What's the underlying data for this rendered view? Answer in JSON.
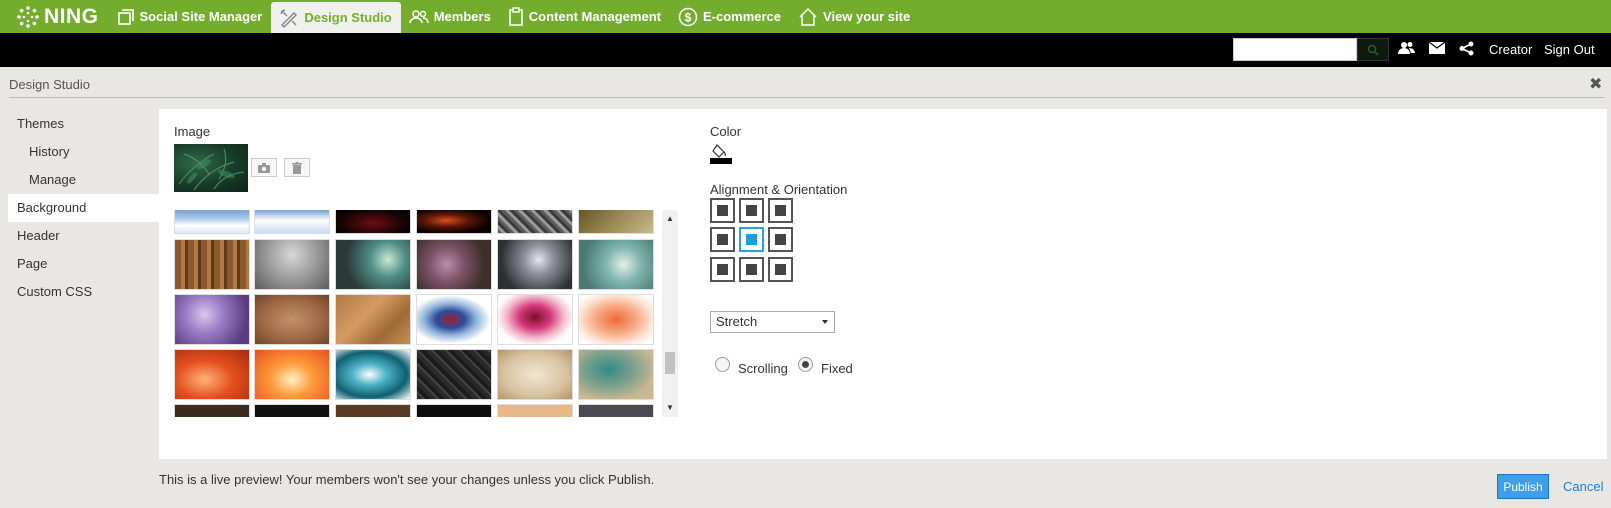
{
  "topnav": {
    "logo": "NING",
    "items": [
      {
        "label": "Social Site Manager",
        "icon": "square-pages-icon"
      },
      {
        "label": "Design Studio",
        "icon": "design-tools-icon"
      },
      {
        "label": "Members",
        "icon": "members-icon"
      },
      {
        "label": "Content Management",
        "icon": "clipboard-icon"
      },
      {
        "label": "E-commerce",
        "icon": "dollar-icon"
      },
      {
        "label": "View your site",
        "icon": "home-icon"
      }
    ],
    "active_index": 1,
    "bg_color": "#74ad2e"
  },
  "userbar": {
    "search_placeholder": "",
    "creator_label": "Creator",
    "signout_label": "Sign Out"
  },
  "studio": {
    "title": "Design Studio",
    "close_glyph": "✖"
  },
  "sidebar": {
    "items": [
      {
        "label": "Themes",
        "sub": false
      },
      {
        "label": "History",
        "sub": true
      },
      {
        "label": "Manage",
        "sub": true
      },
      {
        "label": "Background",
        "sub": false,
        "selected": true
      },
      {
        "label": "Header",
        "sub": false
      },
      {
        "label": "Page",
        "sub": false
      },
      {
        "label": "Custom CSS",
        "sub": false
      }
    ]
  },
  "background": {
    "image_label": "Image",
    "color_label": "Color",
    "color_value": "#000000",
    "alignment_label": "Alignment & Orientation",
    "alignment_selected": "center-center",
    "size_select_value": "Stretch",
    "scroll_options": [
      "Scrolling",
      "Fixed"
    ],
    "scroll_selected": "Fixed",
    "gallery_tiles": [
      "blue sky with clouds",
      "blue sky with white clouds",
      "red light streaks on black",
      "orange light swirl on black",
      "grey cracked stone",
      "olive sand texture",
      "bamboo wood",
      "water droplets",
      "teal bokeh",
      "purple bokeh",
      "grey bokeh",
      "teal bokeh light",
      "violet bokeh",
      "brown leather",
      "brown crumpled paper",
      "blue ink splash",
      "pink ink splash",
      "orange watercolor",
      "orange fire gradient",
      "orange light glow",
      "teal marble swirl",
      "black diamond plate",
      "cream grunge",
      "teal paint splatter"
    ]
  },
  "footer": {
    "note": "This is a live preview! Your members won't see your changes unless you click Publish.",
    "publish_label": "Publish",
    "cancel_label": "Cancel"
  },
  "colors": {
    "nav_green": "#74ad2e",
    "publish_blue": "#3e9ee8",
    "link_blue": "#1e7fd1",
    "align_active": "#1e9ee2"
  }
}
